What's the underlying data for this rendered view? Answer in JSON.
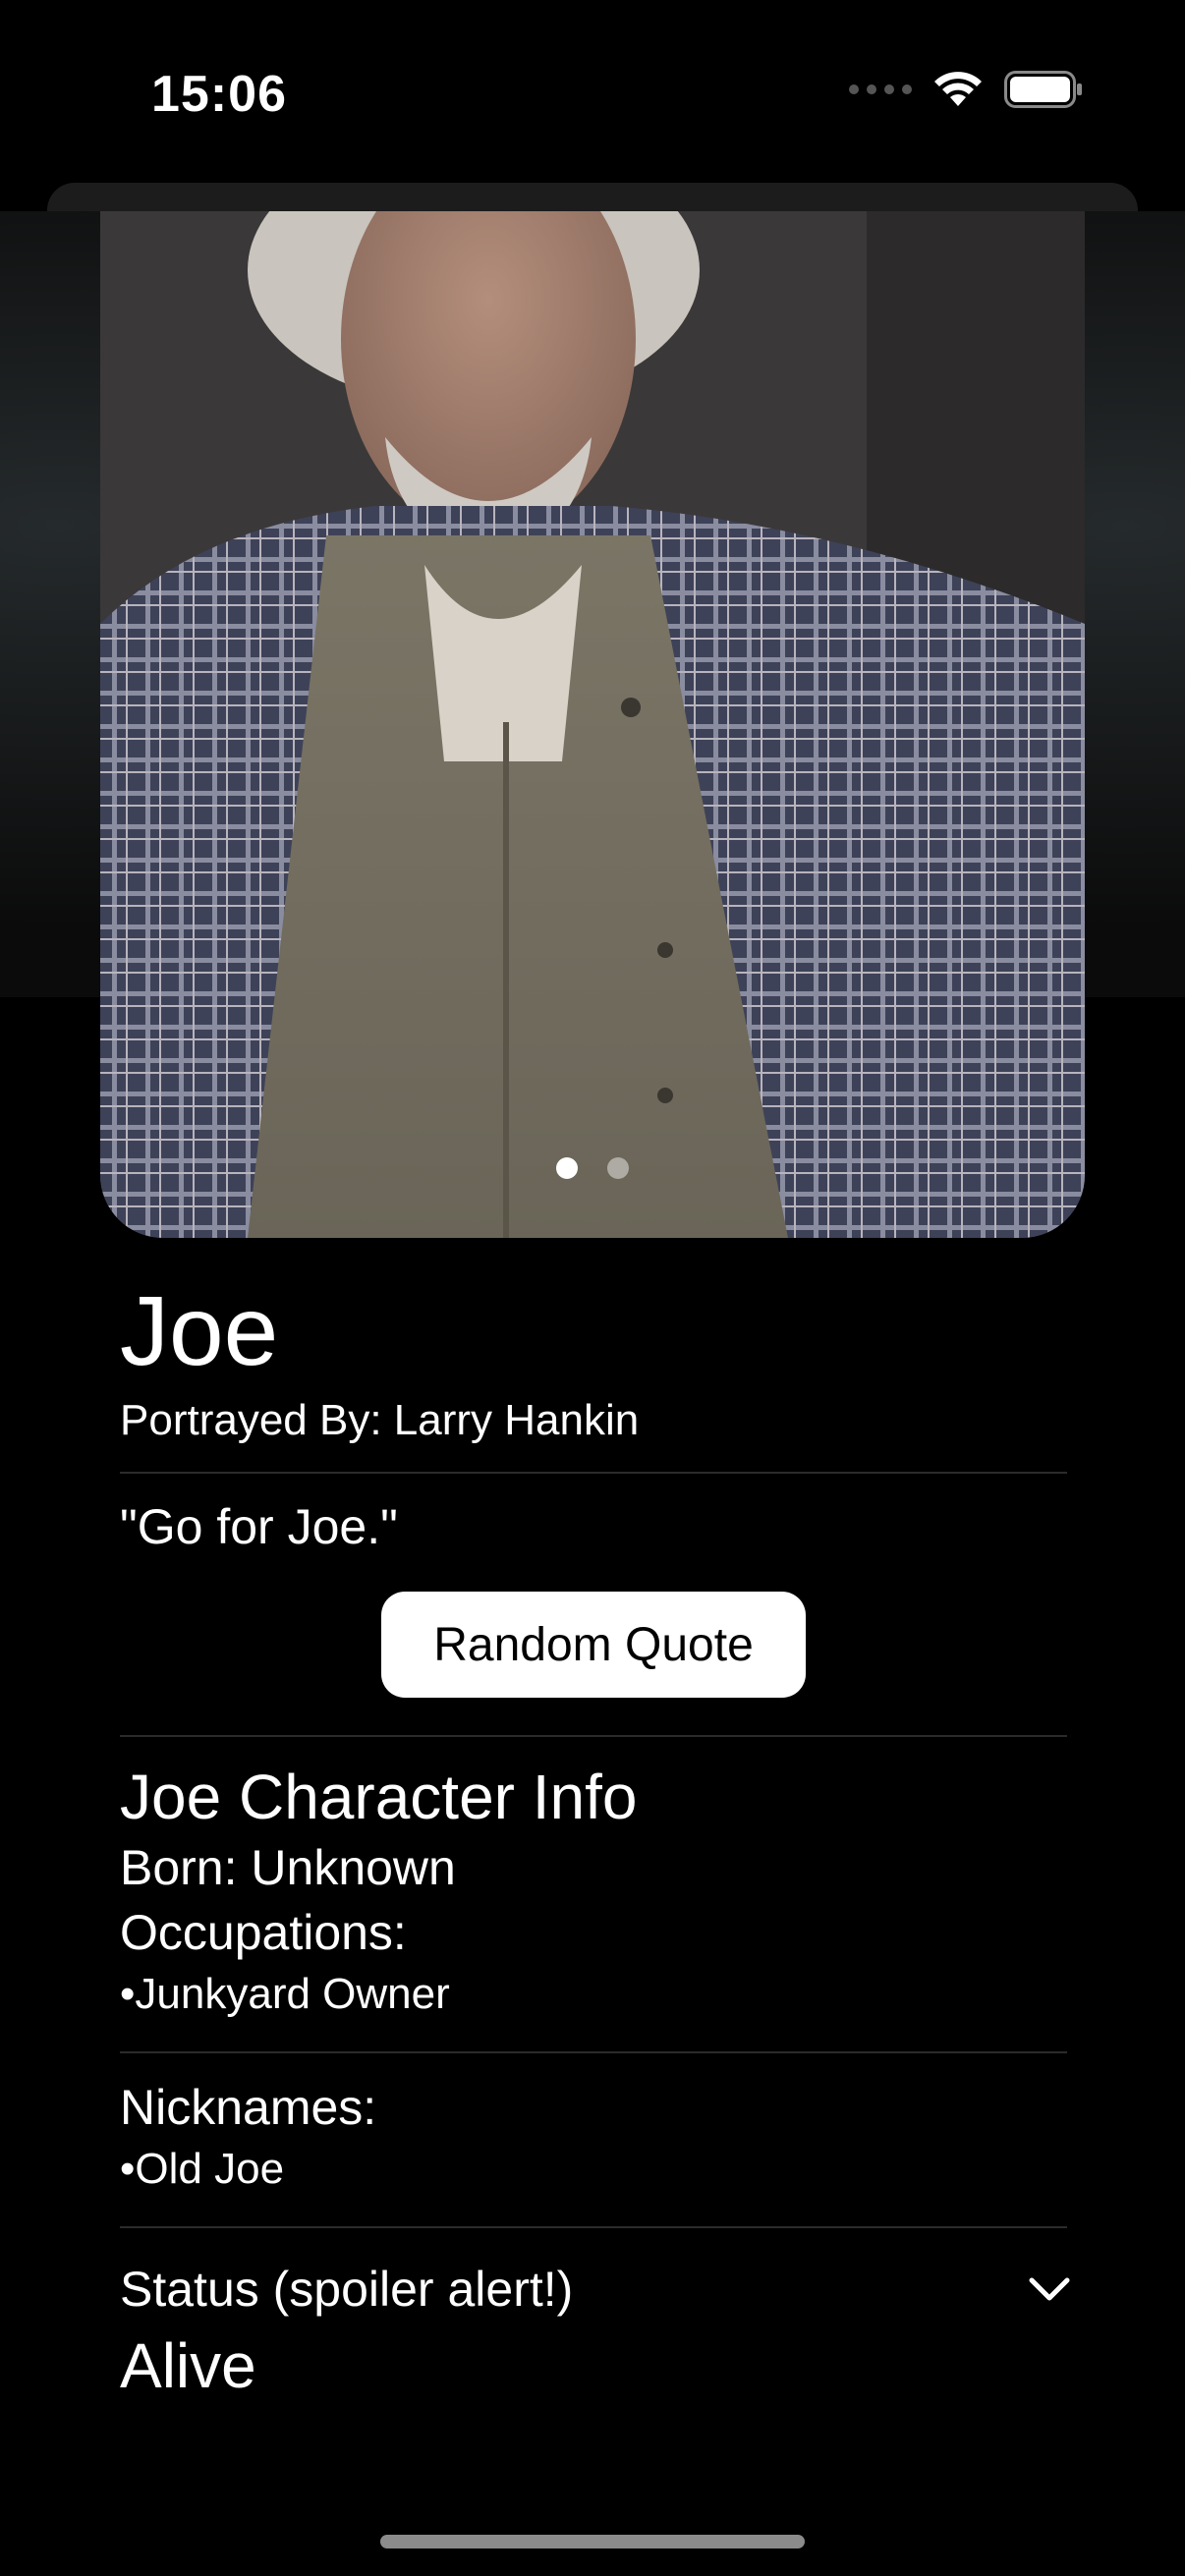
{
  "status_bar": {
    "time": "15:06",
    "icons": [
      "signal-dots-icon",
      "wifi-icon",
      "battery-icon"
    ]
  },
  "carousel": {
    "page_count": 2,
    "current_page": 1
  },
  "character": {
    "name": "Joe",
    "portrayed_by": "Portrayed By: Larry Hankin",
    "quote": "\"Go for Joe.\"",
    "random_quote_label": "Random Quote"
  },
  "info": {
    "title": "Joe Character Info",
    "born": "Born: Unknown",
    "occupations_label": "Occupations:",
    "occupations": [
      "•Junkyard Owner"
    ],
    "nicknames_label": "Nicknames:",
    "nicknames": [
      "•Old Joe"
    ]
  },
  "status": {
    "label": "Status (spoiler alert!)",
    "value": "Alive",
    "chevron": "chevron-down-icon"
  },
  "colors": {
    "background": "#000000",
    "text": "#ffffff",
    "button_bg": "#ffffff",
    "button_text": "#000000",
    "divider": "#2b2b2b"
  }
}
